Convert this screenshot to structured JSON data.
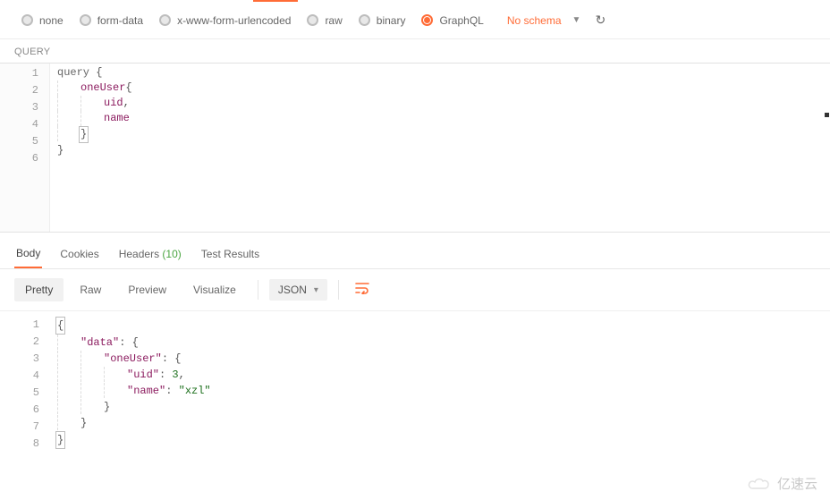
{
  "body_types": {
    "options": [
      {
        "label": "none",
        "selected": false
      },
      {
        "label": "form-data",
        "selected": false
      },
      {
        "label": "x-www-form-urlencoded",
        "selected": false
      },
      {
        "label": "raw",
        "selected": false
      },
      {
        "label": "binary",
        "selected": false
      },
      {
        "label": "GraphQL",
        "selected": true
      }
    ],
    "schema_text": "No schema"
  },
  "query": {
    "label": "QUERY",
    "lines": [
      {
        "n": "1",
        "indent": 0,
        "tokens": [
          {
            "t": "query ",
            "c": "kw"
          },
          {
            "t": "{",
            "c": ""
          }
        ]
      },
      {
        "n": "2",
        "indent": 1,
        "tokens": [
          {
            "t": "oneUser",
            "c": "field"
          },
          {
            "t": "{",
            "c": ""
          }
        ]
      },
      {
        "n": "3",
        "indent": 2,
        "tokens": [
          {
            "t": "uid",
            "c": "prop"
          },
          {
            "t": ",",
            "c": ""
          }
        ]
      },
      {
        "n": "4",
        "indent": 2,
        "tokens": [
          {
            "t": "name",
            "c": "prop"
          }
        ]
      },
      {
        "n": "5",
        "indent": 1,
        "tokens": [
          {
            "t": "}",
            "c": "",
            "hl": true
          }
        ]
      },
      {
        "n": "6",
        "indent": 0,
        "tokens": [
          {
            "t": "}",
            "c": ""
          }
        ]
      }
    ]
  },
  "response_tabs": {
    "items": [
      {
        "label": "Body",
        "active": true
      },
      {
        "label": "Cookies",
        "active": false
      },
      {
        "label": "Headers",
        "count": "(10)",
        "active": false
      },
      {
        "label": "Test Results",
        "active": false
      }
    ]
  },
  "response_toolbar": {
    "view_modes": [
      {
        "label": "Pretty",
        "active": true
      },
      {
        "label": "Raw",
        "active": false
      },
      {
        "label": "Preview",
        "active": false
      },
      {
        "label": "Visualize",
        "active": false
      }
    ],
    "format": "JSON"
  },
  "response_body": {
    "lines": [
      {
        "n": "1",
        "indent": 0,
        "tokens": [
          {
            "t": "{",
            "c": "",
            "hl": true
          }
        ]
      },
      {
        "n": "2",
        "indent": 1,
        "tokens": [
          {
            "t": "\"data\"",
            "c": "jkey"
          },
          {
            "t": ": {",
            "c": ""
          }
        ]
      },
      {
        "n": "3",
        "indent": 2,
        "tokens": [
          {
            "t": "\"oneUser\"",
            "c": "jkey"
          },
          {
            "t": ": {",
            "c": ""
          }
        ]
      },
      {
        "n": "4",
        "indent": 3,
        "tokens": [
          {
            "t": "\"uid\"",
            "c": "jkey"
          },
          {
            "t": ": ",
            "c": ""
          },
          {
            "t": "3",
            "c": "jnum"
          },
          {
            "t": ",",
            "c": ""
          }
        ]
      },
      {
        "n": "5",
        "indent": 3,
        "tokens": [
          {
            "t": "\"name\"",
            "c": "jkey"
          },
          {
            "t": ": ",
            "c": ""
          },
          {
            "t": "\"xzl\"",
            "c": "jstr"
          }
        ]
      },
      {
        "n": "6",
        "indent": 2,
        "tokens": [
          {
            "t": "}",
            "c": ""
          }
        ]
      },
      {
        "n": "7",
        "indent": 1,
        "tokens": [
          {
            "t": "}",
            "c": ""
          }
        ]
      },
      {
        "n": "8",
        "indent": 0,
        "tokens": [
          {
            "t": "}",
            "c": "",
            "hl": true
          }
        ]
      }
    ]
  },
  "watermark": "亿速云"
}
